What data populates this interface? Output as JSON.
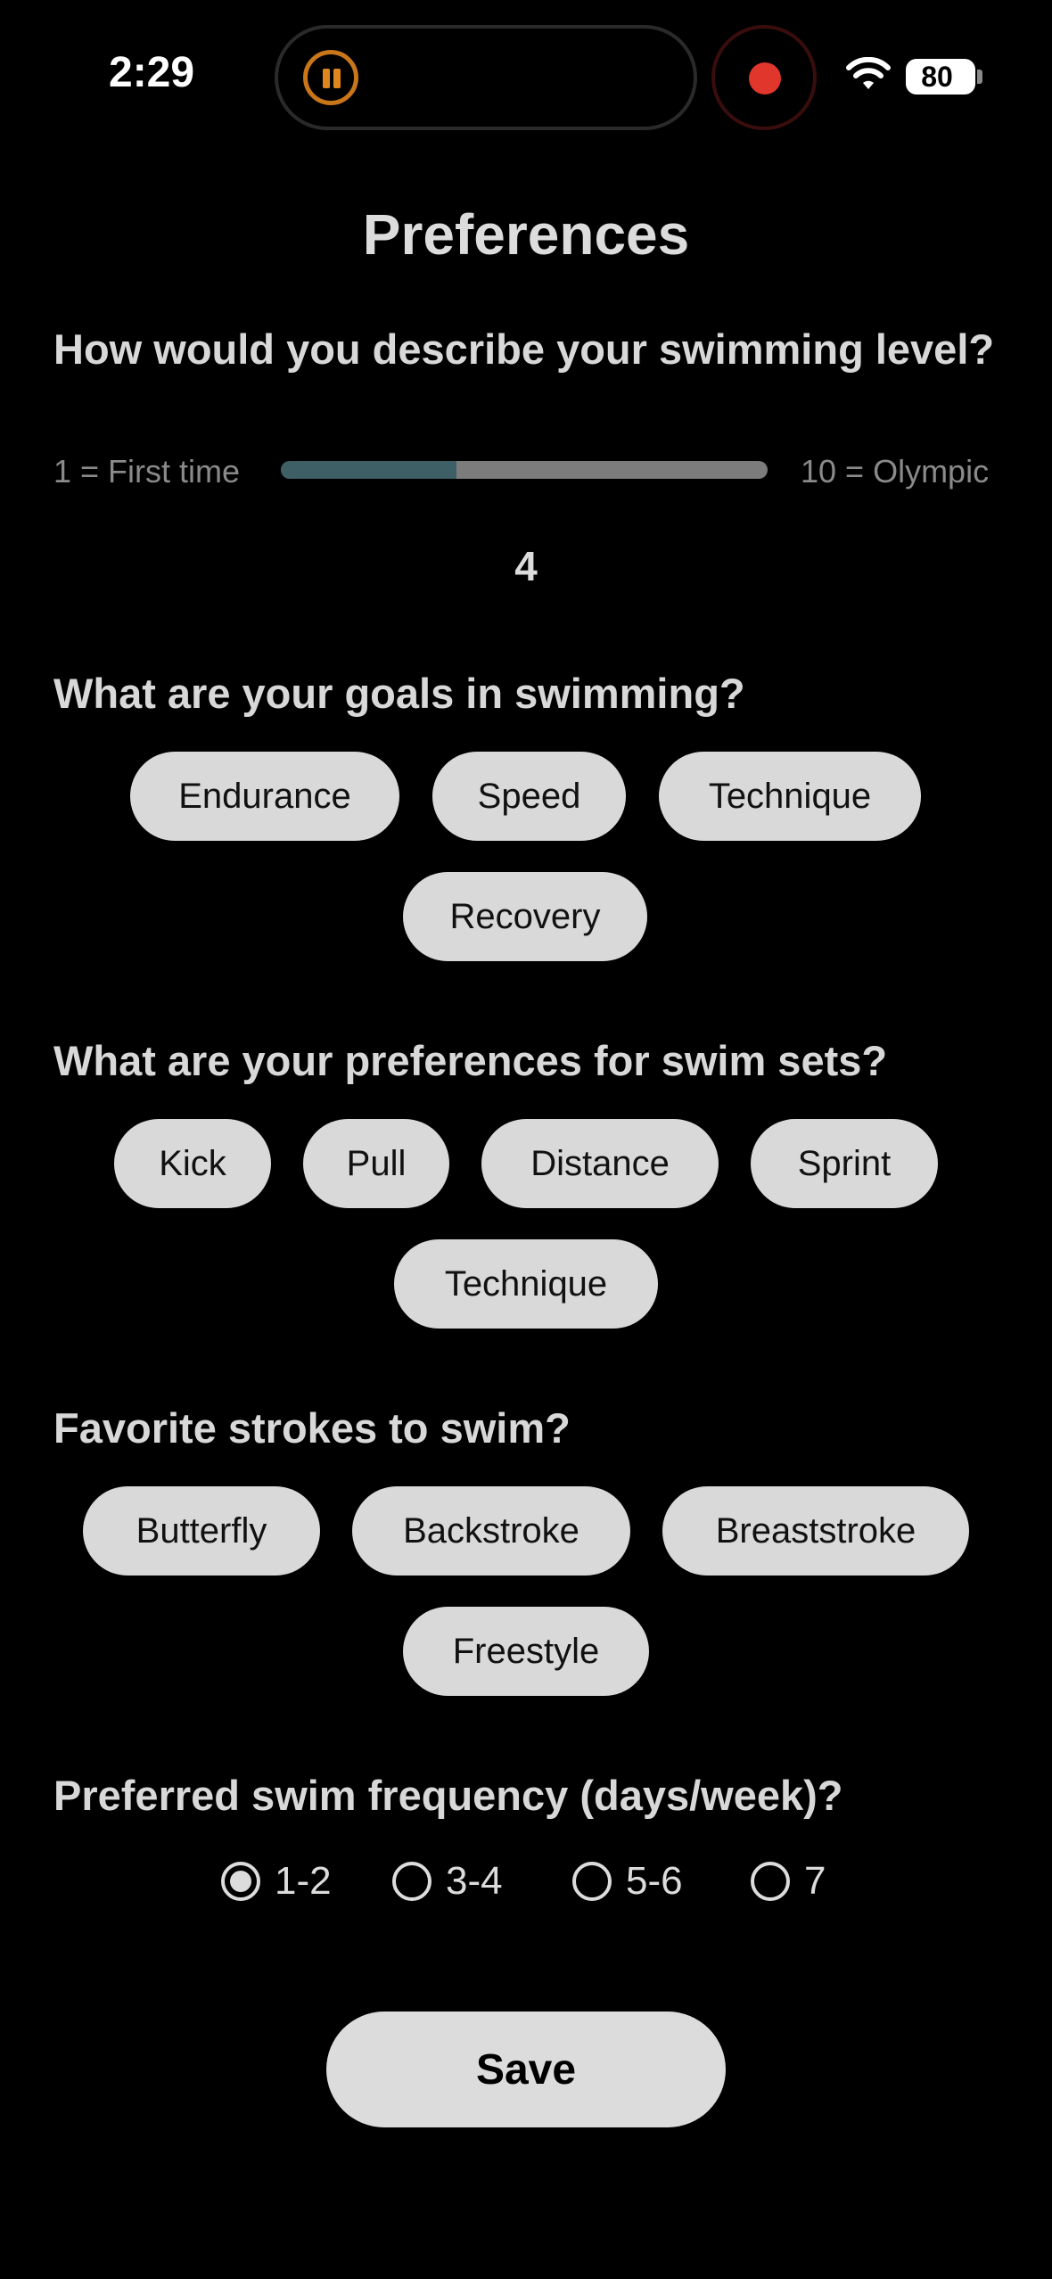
{
  "status_bar": {
    "time": "2:29",
    "battery": "80"
  },
  "title": "Preferences",
  "swim_level": {
    "question": "How would you describe your swimming level?",
    "min_label": "1 = First time",
    "max_label": "10 = Olympic",
    "value": "4",
    "fill_fraction": 0.36
  },
  "goals": {
    "question": "What are your goals in swimming?",
    "options": [
      "Endurance",
      "Speed",
      "Technique",
      "Recovery"
    ]
  },
  "sets": {
    "question": "What are your preferences for swim sets?",
    "options": [
      "Kick",
      "Pull",
      "Distance",
      "Sprint",
      "Technique"
    ]
  },
  "strokes": {
    "question": "Favorite strokes to swim?",
    "options": [
      "Butterfly",
      "Backstroke",
      "Breaststroke",
      "Freestyle"
    ]
  },
  "frequency": {
    "question": "Preferred swim frequency (days/week)?",
    "options": [
      "1-2",
      "3-4",
      "5-6",
      "7"
    ],
    "selected": "1-2"
  },
  "save_label": "Save",
  "colors": {
    "slider_fill": "#3e5f65",
    "chip_bg": "#d9d9d9",
    "record": "#e0362c",
    "pause": "#e0861f"
  }
}
